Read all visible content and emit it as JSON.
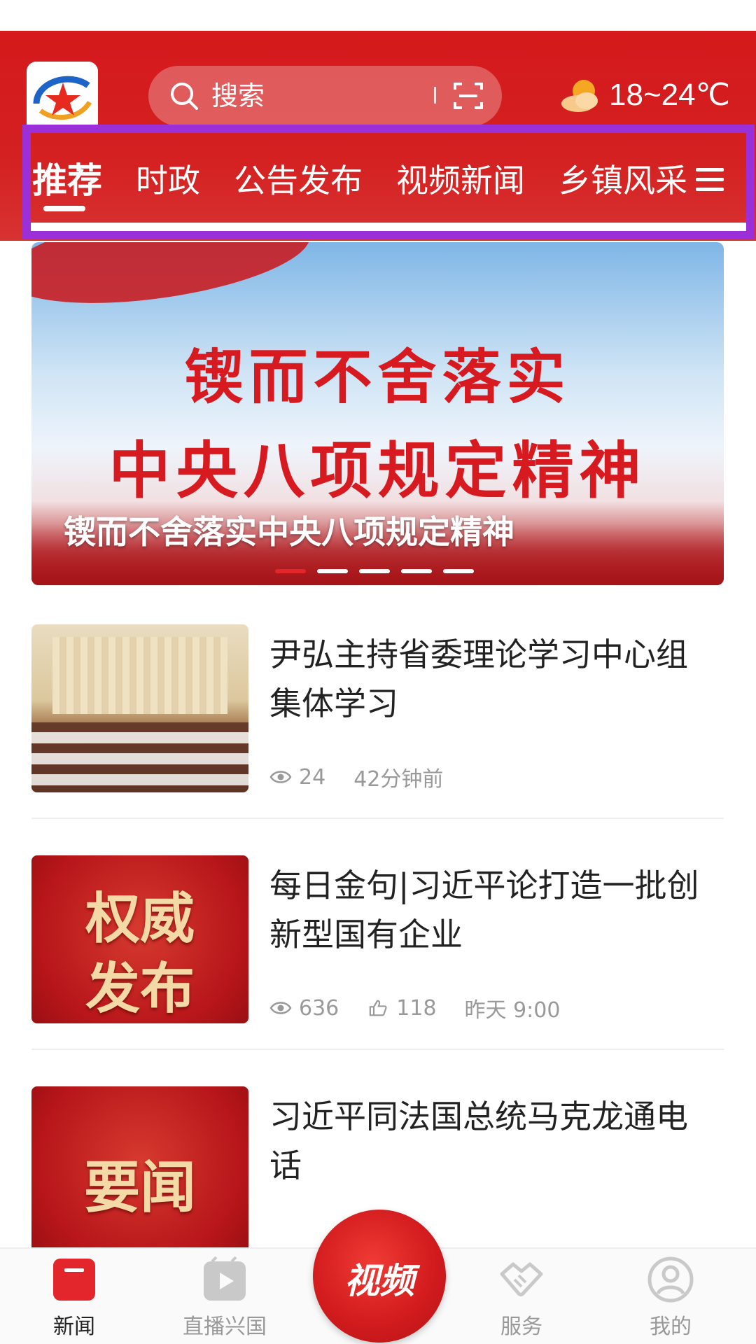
{
  "header": {
    "search_placeholder": "搜索",
    "weather_text": "18~24℃"
  },
  "tabs": [
    {
      "label": "推荐",
      "active": true
    },
    {
      "label": "时政",
      "active": false
    },
    {
      "label": "公告发布",
      "active": false
    },
    {
      "label": "视频新闻",
      "active": false
    },
    {
      "label": "乡镇风采",
      "active": false
    }
  ],
  "banner": {
    "headline_line1": "锲而不舍落实",
    "headline_line2": "中央八项规定精神",
    "caption": "锲而不舍落实中央八项规定精神",
    "dot_count": 5,
    "active_dot": 0
  },
  "news": [
    {
      "title": "尹弘主持省委理论学习中心组集体学习",
      "views": "24",
      "likes": null,
      "time": "42分钟前",
      "thumb_type": "meeting"
    },
    {
      "title": "每日金句|习近平论打造一批创新型国有企业",
      "views": "636",
      "likes": "118",
      "time": "昨天 9:00",
      "thumb_type": "stamp",
      "thumb_text_line1": "权威",
      "thumb_text_line2": "发布"
    },
    {
      "title": "习近平同法国总统马克龙通电话",
      "thumb_type": "stamp",
      "thumb_text_line1": "要闻"
    }
  ],
  "bottom_nav": {
    "items": [
      {
        "label": "新闻",
        "icon": "news-icon",
        "active": true
      },
      {
        "label": "直播兴国",
        "icon": "live-icon",
        "active": false
      },
      {
        "label": "服务",
        "icon": "handshake-icon",
        "active": false
      },
      {
        "label": "我的",
        "icon": "profile-icon",
        "active": false
      }
    ],
    "center_label": "视频"
  },
  "colors": {
    "brand_red": "#d5191c",
    "highlight_purple": "#9b30d8",
    "meta_gray": "#999999"
  }
}
